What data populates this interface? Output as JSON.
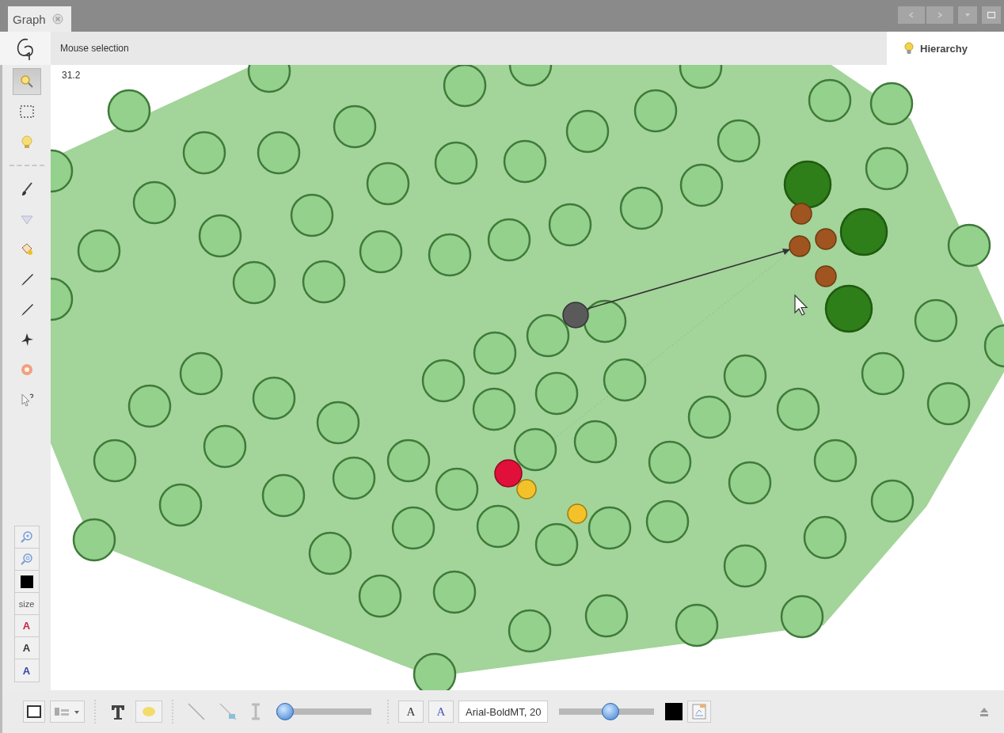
{
  "tabs": [
    {
      "label": "Graph",
      "selected": true
    }
  ],
  "toolbar": {
    "mode": "Mouse selection",
    "hierarchy": "Hierarchy"
  },
  "tools": [
    {
      "kind": "select",
      "selected": true
    },
    {
      "kind": "rect-select",
      "selected": false
    },
    {
      "kind": "glow",
      "selected": false
    },
    {
      "kind": "separator"
    },
    {
      "kind": "brush",
      "selected": false
    },
    {
      "kind": "diamond",
      "selected": false
    },
    {
      "kind": "painter",
      "selected": false
    },
    {
      "kind": "pencil",
      "selected": false
    },
    {
      "kind": "pencil",
      "selected": false
    },
    {
      "kind": "plane",
      "selected": false
    },
    {
      "kind": "flower",
      "selected": false
    },
    {
      "kind": "cursor",
      "selected": false
    }
  ],
  "canvas": {
    "zoom": "31.2"
  },
  "side_buttons": [
    {
      "kind": "zoom-in"
    },
    {
      "kind": "zoom-out"
    },
    {
      "kind": "swatch",
      "color": "#000000"
    },
    {
      "kind": "text",
      "label": "size",
      "color": "#555555"
    },
    {
      "kind": "text",
      "label": "A",
      "color": "#cc2244"
    },
    {
      "kind": "text",
      "label": "A",
      "color": "#333333"
    },
    {
      "kind": "text",
      "label": "A",
      "color": "#3344aa"
    }
  ],
  "bottom": {
    "text_size": {
      "level": 0.0
    },
    "font_buttons": [
      {
        "label": "A",
        "color": "#333333"
      },
      {
        "label": "A",
        "color": "#4455bb"
      }
    ],
    "font": "Arial-BoldMT, 20",
    "label_size": {
      "level": 0.55
    },
    "swatch": {
      "color": "#000000"
    }
  }
}
